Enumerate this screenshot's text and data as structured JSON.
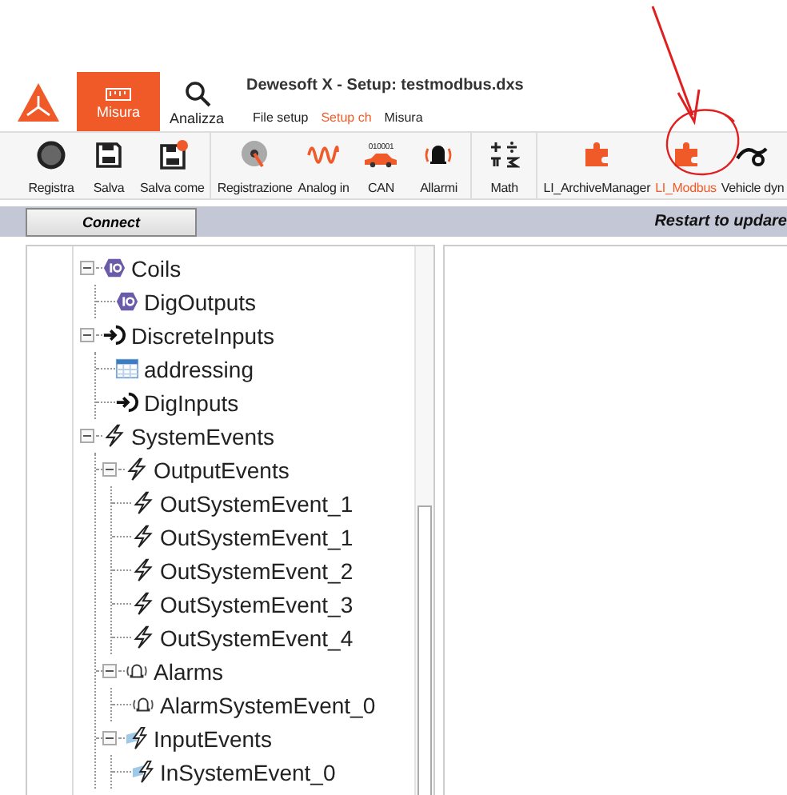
{
  "header": {
    "tabs": [
      {
        "label": "Misura",
        "selected": true,
        "kind": "ruler"
      },
      {
        "label": "Analizza",
        "selected": false,
        "kind": "search"
      }
    ],
    "title": "Dewesoft X - Setup: testmodbus.dxs",
    "subtabs": [
      {
        "label": "File setup",
        "selected": false
      },
      {
        "label": "Setup ch",
        "selected": true
      },
      {
        "label": "Misura",
        "selected": false
      }
    ]
  },
  "toolbar": [
    [
      {
        "label": "Registra",
        "kind": "record",
        "selected": false
      },
      {
        "label": "Salva",
        "kind": "save",
        "selected": false
      },
      {
        "label": "Salva come",
        "kind": "saveas",
        "selected": false
      }
    ],
    [
      {
        "label": "Registrazione",
        "kind": "disk",
        "selected": false
      },
      {
        "label": "Analog in",
        "kind": "wave",
        "selected": false
      },
      {
        "label": "CAN",
        "kind": "car",
        "icon_text": "010001",
        "selected": false
      },
      {
        "label": "Allarmi",
        "kind": "alarm",
        "selected": false
      }
    ],
    [
      {
        "label": "Math",
        "kind": "math",
        "selected": false
      }
    ],
    [
      {
        "label": "LI_ArchiveManager",
        "kind": "plugin",
        "selected": false
      },
      {
        "label": "LI_Modbus",
        "kind": "plugin",
        "selected": true
      },
      {
        "label": "Vehicle dyn",
        "kind": "vehicle",
        "selected": false
      }
    ]
  ],
  "connect_bar": {
    "button": "Connect",
    "message": "Restart to updare"
  },
  "tree": [
    {
      "label": "Coils",
      "kind": "coil",
      "expanded": true,
      "children": [
        {
          "label": "DigOutputs",
          "kind": "coil"
        }
      ]
    },
    {
      "label": "DiscreteInputs",
      "kind": "input",
      "expanded": true,
      "children": [
        {
          "label": "addressing",
          "kind": "table"
        },
        {
          "label": "DigInputs",
          "kind": "input"
        }
      ]
    },
    {
      "label": "SystemEvents",
      "kind": "event",
      "expanded": true,
      "children": [
        {
          "label": "OutputEvents",
          "kind": "event",
          "expanded": true,
          "children": [
            {
              "label": "OutSystemEvent_1",
              "kind": "event"
            },
            {
              "label": "OutSystemEvent_1",
              "kind": "event"
            },
            {
              "label": "OutSystemEvent_2",
              "kind": "event"
            },
            {
              "label": "OutSystemEvent_3",
              "kind": "event"
            },
            {
              "label": "OutSystemEvent_4",
              "kind": "event"
            }
          ]
        },
        {
          "label": "Alarms",
          "kind": "alarm",
          "expanded": true,
          "children": [
            {
              "label": "AlarmSystemEvent_0",
              "kind": "alarm"
            }
          ]
        },
        {
          "label": "InputEvents",
          "kind": "inevent",
          "expanded": true,
          "children": [
            {
              "label": "InSystemEvent_0",
              "kind": "inevent"
            }
          ]
        }
      ]
    }
  ]
}
